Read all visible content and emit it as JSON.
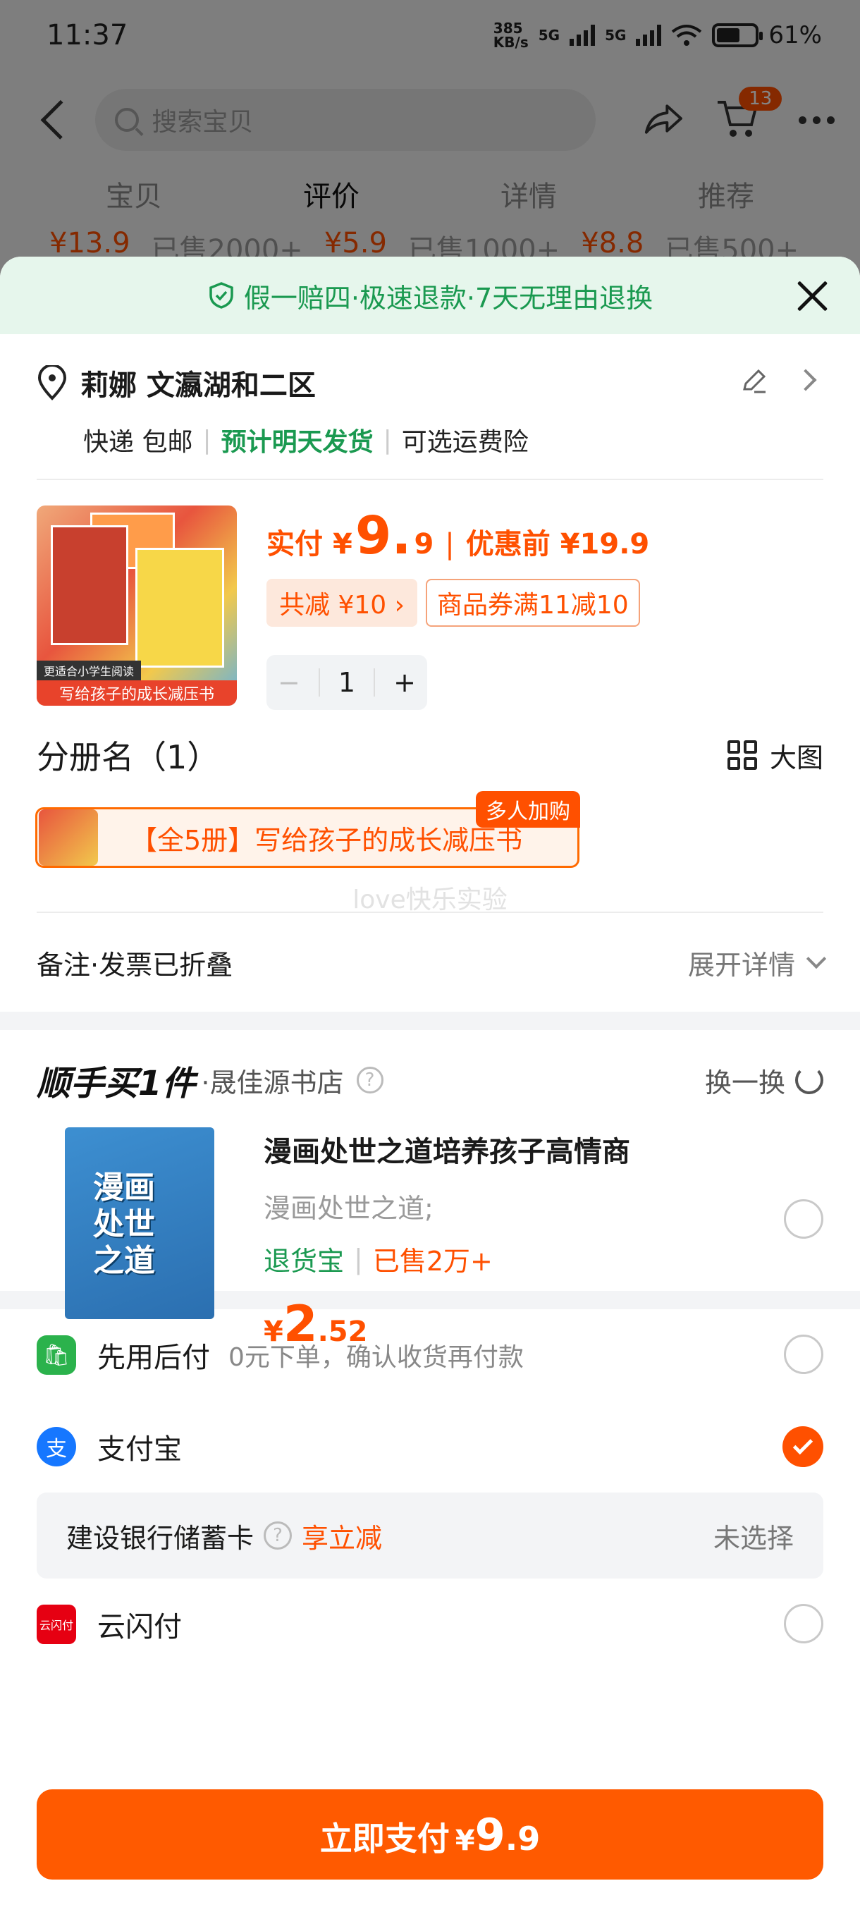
{
  "status_bar": {
    "time": "11:37",
    "net_speed_top": "385",
    "net_speed_bottom": "KB/s",
    "sig1": "5G",
    "sig2": "5G",
    "battery": "61%"
  },
  "background": {
    "search_placeholder": "搜索宝贝",
    "cart_count": "13",
    "tabs": [
      "宝贝",
      "评价",
      "详情",
      "推荐"
    ],
    "peek": [
      {
        "price": "¥13.9",
        "sold": "已售2000+"
      },
      {
        "price": "¥5.9",
        "sold": "已售1000+"
      },
      {
        "price": "¥8.8",
        "sold": "已售500+"
      }
    ]
  },
  "sheet": {
    "guarantee": "假一赔四·极速退款·7天无理由退换",
    "address": {
      "name_line": "莉娜 文瀛湖和二区",
      "shipping": "快递 包邮",
      "sep": "|",
      "eta": "预计明天发货",
      "insurance": "可选运费险"
    },
    "product": {
      "thumb_tag": "更适合小学生阅读",
      "thumb_banner": "写给孩子的成长减压书",
      "pay_prefix": "实付",
      "currency": "¥",
      "price_int": "9.",
      "price_dec": "9",
      "bar": "|",
      "original": "优惠前 ¥19.9",
      "discount": "共减 ¥10 ›",
      "coupon": "商品券满11减10",
      "qty_minus": "−",
      "qty": "1",
      "qty_plus": "+"
    },
    "variant": {
      "title": "分册名（1）",
      "big_view": "大图",
      "option": "【全5册】写给孩子的成长减压书",
      "badge": "多人加购",
      "watermark": "love快乐实验"
    },
    "remark": {
      "label": "备注·发票已折叠",
      "expand": "展开详情"
    },
    "addon": {
      "brand": "顺手买1件",
      "store": "·晟佳源书店",
      "q": "?",
      "swap": "换一换",
      "thumb_text": "漫画处世之道",
      "name": "漫画处世之道培养孩子高情商",
      "sub": "漫画处世之道;",
      "tag_return": "退货宝",
      "tag_sep": "|",
      "tag_sold": "已售2万+",
      "currency": "¥",
      "price_int": "2",
      "price_dec": ".52"
    },
    "payment": {
      "later": {
        "icon": "🛍",
        "label": "先用后付",
        "hint": "0元下单，确认收货再付款"
      },
      "alipay": {
        "icon": "支",
        "label": "支付宝"
      },
      "bank": {
        "label": "建设银行储蓄卡",
        "q": "?",
        "cut": "享立减",
        "state": "未选择"
      },
      "unionpay": {
        "icon": "云闪付",
        "label": "云闪付"
      }
    },
    "pay_button": {
      "label": "立即支付",
      "currency": "¥",
      "int": "9",
      "dec": ".9"
    }
  },
  "colors": {
    "accent": "#ff5000",
    "green": "#1a9950",
    "guarantee_bg": "#e6f6ec"
  }
}
